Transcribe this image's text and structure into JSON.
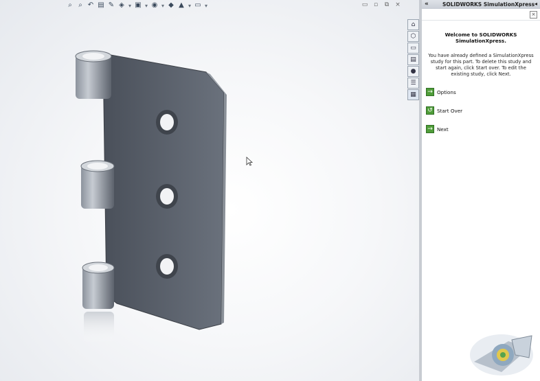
{
  "hud": {
    "buttons": [
      {
        "icon": "zoom-to-fit-icon",
        "glyph": "⌕"
      },
      {
        "icon": "zoom-to-area-icon",
        "glyph": "⌕"
      },
      {
        "icon": "previous-view-icon",
        "glyph": "↶"
      },
      {
        "icon": "section-view-icon",
        "glyph": "▤"
      },
      {
        "icon": "dynamic-annotation-icon",
        "glyph": "✎"
      },
      {
        "icon": "view-orientation-icon",
        "glyph": "◈"
      },
      {
        "icon": "display-style-icon",
        "glyph": "▣"
      },
      {
        "icon": "hide-show-items-icon",
        "glyph": "◉"
      },
      {
        "icon": "edit-appearance-icon",
        "glyph": "◆"
      },
      {
        "icon": "apply-scene-icon",
        "glyph": "▲"
      },
      {
        "icon": "view-settings-icon",
        "glyph": "▭"
      }
    ],
    "dropdown_glyph": "▾"
  },
  "window_controls": {
    "min": "▭",
    "restore": "▫",
    "max": "⧉",
    "close": "×"
  },
  "taskpane": {
    "tabs": [
      {
        "name": "tab-resources",
        "glyph": "⌂"
      },
      {
        "name": "tab-design-library",
        "glyph": "⬡"
      },
      {
        "name": "tab-file-explorer",
        "glyph": "▭"
      },
      {
        "name": "tab-view-palette",
        "glyph": "▤"
      },
      {
        "name": "tab-appearances",
        "glyph": "●"
      },
      {
        "name": "tab-custom-properties",
        "glyph": "☰"
      },
      {
        "name": "tab-simulationxpress",
        "glyph": "▦"
      }
    ]
  },
  "sidebar": {
    "collapse": "«",
    "title": "SOLIDWORKS SimulationXpress",
    "pin": "◂",
    "close": "×",
    "welcome": "Welcome to SOLIDWORKS SimulationXpress.",
    "message": "You have already defined a SimulationXpress study for this part. To delete this study and start again, click Start over. To edit the existing study, click Next.",
    "actions": [
      {
        "label": "Options",
        "icon": "options-icon",
        "glyph": "→"
      },
      {
        "label": "Start Over",
        "icon": "start-over-icon",
        "glyph": "↺"
      },
      {
        "label": "Next",
        "icon": "next-icon",
        "glyph": "→"
      }
    ]
  },
  "colors": {
    "sidebar_bg": "#ffffff",
    "action_green": "#4f9d39",
    "model_metal": "#5f6673"
  }
}
